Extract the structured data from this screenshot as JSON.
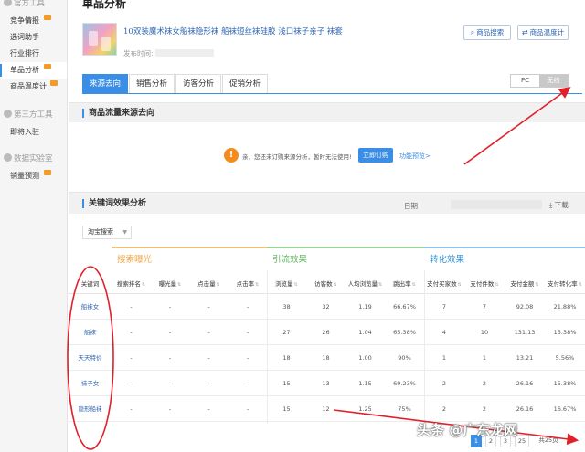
{
  "sidebar": {
    "groups": [
      {
        "label": "官方工具",
        "items": [
          {
            "label": "竞争情报",
            "badge": true
          },
          {
            "label": "选词助手",
            "badge": false
          },
          {
            "label": "行业排行",
            "badge": false
          },
          {
            "label": "单品分析",
            "badge": true,
            "active": true
          },
          {
            "label": "商品温度计",
            "badge": true
          }
        ]
      },
      {
        "label": "第三方工具",
        "items": [
          {
            "label": "即将入驻",
            "badge": false
          }
        ]
      },
      {
        "label": "数据实验室",
        "items": [
          {
            "label": "销量预测",
            "badge": true
          }
        ]
      }
    ]
  },
  "header": {
    "page_title": "单品分析",
    "product_name": "10双装魔术袜女船袜隐形袜  船袜短丝袜硅胶  浅口袜子亲子  袜套",
    "publish_label": "发布时间:",
    "btn_product_search": "商品搜索",
    "btn_thermometer": "商品温度计"
  },
  "tabs": [
    {
      "label": "来源去向",
      "active": true
    },
    {
      "label": "销售分析",
      "active": false
    },
    {
      "label": "访客分析",
      "active": false
    },
    {
      "label": "促销分析",
      "active": false
    }
  ],
  "device_toggle": {
    "pc": "PC",
    "wireless": "无线",
    "selected": "wireless"
  },
  "traffic_section": {
    "title": "商品流量来源去向",
    "notice": "亲，您还未订购来源分析，暂时无法使用!",
    "buy_button": "立即订购",
    "preview_link": "功能预览>"
  },
  "keyword_section": {
    "title": "关键词效果分析",
    "date_label": "日期",
    "download": "下载",
    "source_select": "淘宝搜索",
    "groups": [
      "搜索曝光",
      "引流效果",
      "转化效果"
    ],
    "columns": [
      "关键词",
      "搜索排名",
      "曝光量",
      "点击量",
      "点击率",
      "浏览量",
      "访客数",
      "人均浏览量",
      "跳出率",
      "支付买家数",
      "支付件数",
      "支付金额",
      "支付转化率"
    ],
    "rows": [
      [
        "船袜女",
        "-",
        "-",
        "-",
        "-",
        "38",
        "32",
        "1.19",
        "66.67%",
        "7",
        "7",
        "92.08",
        "21.88%"
      ],
      [
        "船袜",
        "-",
        "-",
        "-",
        "-",
        "27",
        "26",
        "1.04",
        "65.38%",
        "4",
        "10",
        "131.13",
        "15.38%"
      ],
      [
        "天天特价",
        "-",
        "-",
        "-",
        "-",
        "18",
        "18",
        "1.00",
        "90%",
        "1",
        "1",
        "13.21",
        "5.56%"
      ],
      [
        "袜子女",
        "-",
        "-",
        "-",
        "-",
        "15",
        "13",
        "1.15",
        "69.23%",
        "2",
        "2",
        "26.16",
        "15.38%"
      ],
      [
        "隐形船袜",
        "-",
        "-",
        "-",
        "-",
        "15",
        "12",
        "1.25",
        "75%",
        "2",
        "2",
        "26.16",
        "16.67%"
      ]
    ]
  },
  "pagination": {
    "pages": [
      "1",
      "2",
      "3",
      "25"
    ],
    "total": "共25页"
  },
  "watermark": "头条 @广东龙网",
  "colors": {
    "accent": "#3a8ee6",
    "annotation": "#e0202a",
    "badge": "#f39a28"
  }
}
